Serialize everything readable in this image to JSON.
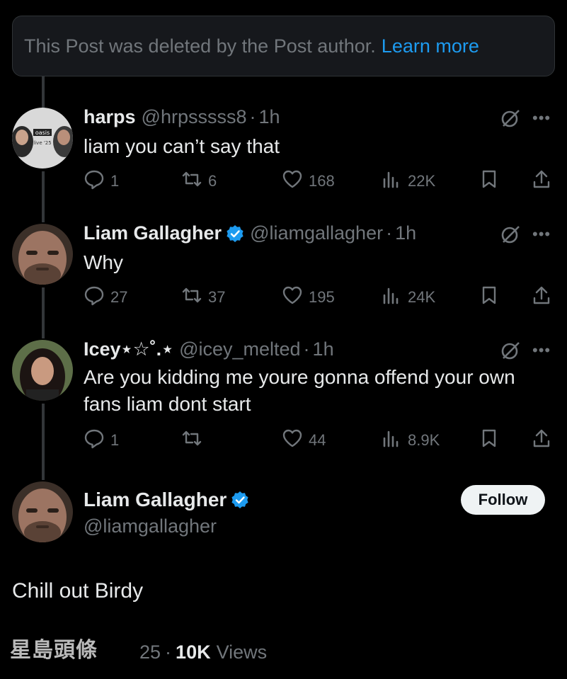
{
  "deleted_notice": {
    "text": "This Post was deleted by the Post author.",
    "link": "Learn more"
  },
  "replies": [
    {
      "name": "harps",
      "handle": "@hrpsssss8",
      "time": "1h",
      "verified": false,
      "text": [
        "liam you can’t say that"
      ],
      "replies": "1",
      "reposts": "6",
      "likes": "168",
      "views": "22K",
      "avatar_text": "oasis live '25"
    },
    {
      "name": "Liam Gallagher",
      "handle": "@liamgallagher",
      "time": "1h",
      "verified": true,
      "text": [
        "Why"
      ],
      "replies": "27",
      "reposts": "37",
      "likes": "195",
      "views": "24K"
    },
    {
      "name": "Icey⋆☆˚.⋆",
      "handle": "@icey_melted",
      "time": "1h",
      "verified": false,
      "text": [
        "Are you kidding me youre gonna offend your own",
        "fans liam dont start"
      ],
      "replies": "1",
      "reposts": "",
      "likes": "44",
      "views": "8.9K"
    }
  ],
  "main_post": {
    "name": "Liam Gallagher",
    "handle": "@liamgallagher",
    "verified": true,
    "follow_label": "Follow",
    "text": "Chill out Birdy",
    "date_partial": "25",
    "views_count": "10K",
    "views_label": "Views"
  },
  "watermark": "星島頭條",
  "colors": {
    "background": "#000000",
    "accent": "#1d9bf0",
    "muted": "#71767b",
    "text": "#e7e9ea"
  },
  "icons": [
    "grok-icon",
    "more-icon",
    "reply-icon",
    "repost-icon",
    "like-icon",
    "views-icon",
    "bookmark-icon",
    "share-icon",
    "verified-badge-icon"
  ]
}
